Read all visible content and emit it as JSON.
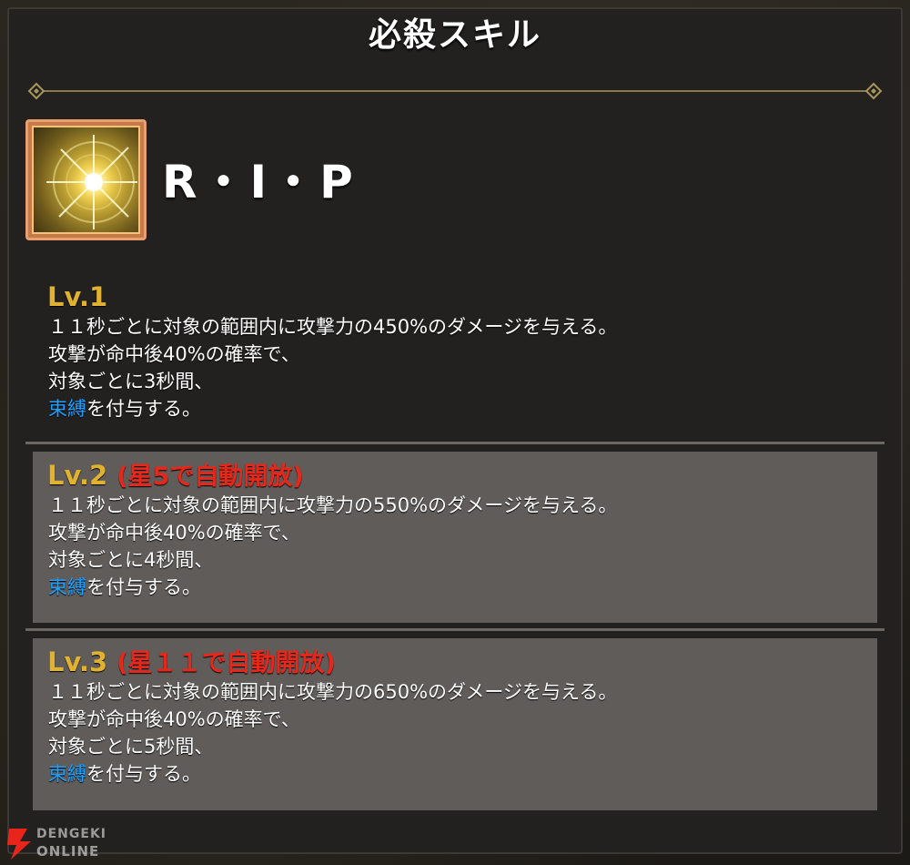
{
  "title": "必殺スキル",
  "skill": {
    "name": "R・I・P",
    "icon": "light-burst-skill-icon"
  },
  "keyword_color": "#1da0ff",
  "levels": [
    {
      "label": "Lv.1",
      "unlock": "",
      "lines": [
        "１１秒ごとに対象の範囲内に攻撃力の450%のダメージを与える。",
        "攻撃が命中後40%の確率で、",
        "対象ごとに3秒間、"
      ],
      "keyword": "束縛",
      "keyword_suffix": "を付与する。"
    },
    {
      "label": "Lv.2",
      "unlock": "(星5で自動開放)",
      "lines": [
        "１１秒ごとに対象の範囲内に攻撃力の550%のダメージを与える。",
        "攻撃が命中後40%の確率で、",
        "対象ごとに4秒間、"
      ],
      "keyword": "束縛",
      "keyword_suffix": "を付与する。"
    },
    {
      "label": "Lv.3",
      "unlock": "(星１１で自動開放)",
      "lines": [
        "１１秒ごとに対象の範囲内に攻撃力の650%のダメージを与える。",
        "攻撃が命中後40%の確率で、",
        "対象ごとに5秒間、"
      ],
      "keyword": "束縛",
      "keyword_suffix": "を付与する。"
    }
  ],
  "watermark": {
    "line1": "DENGEKI",
    "line2": "ONLINE"
  }
}
